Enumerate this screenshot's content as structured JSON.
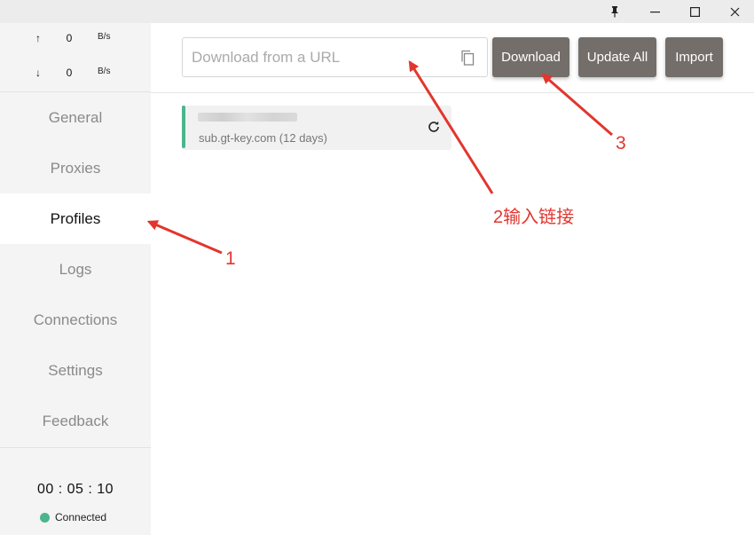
{
  "titlebar": {
    "controls": [
      "pin-icon",
      "minimize-icon",
      "maximize-icon",
      "close-icon"
    ]
  },
  "traffic": {
    "up": {
      "arrow": "↑",
      "value": "0",
      "unit": "B/s"
    },
    "down": {
      "arrow": "↓",
      "value": "0",
      "unit": "B/s"
    }
  },
  "nav": {
    "items": [
      {
        "label": "General"
      },
      {
        "label": "Proxies"
      },
      {
        "label": "Profiles",
        "active": true
      },
      {
        "label": "Logs"
      },
      {
        "label": "Connections"
      },
      {
        "label": "Settings"
      },
      {
        "label": "Feedback"
      }
    ]
  },
  "status": {
    "timer": "00 : 05 : 10",
    "connection": "Connected",
    "color": "#4bb58b"
  },
  "toolbar": {
    "url_placeholder": "Download from a URL",
    "url_value": "",
    "download_label": "Download",
    "update_all_label": "Update All",
    "import_label": "Import"
  },
  "profile": {
    "subtitle": "sub.gt-key.com (12 days)",
    "accent": "#4bb58b"
  },
  "annotations": {
    "one": "1",
    "two": "2输入链接",
    "three": "3",
    "color": "#e2362e"
  }
}
